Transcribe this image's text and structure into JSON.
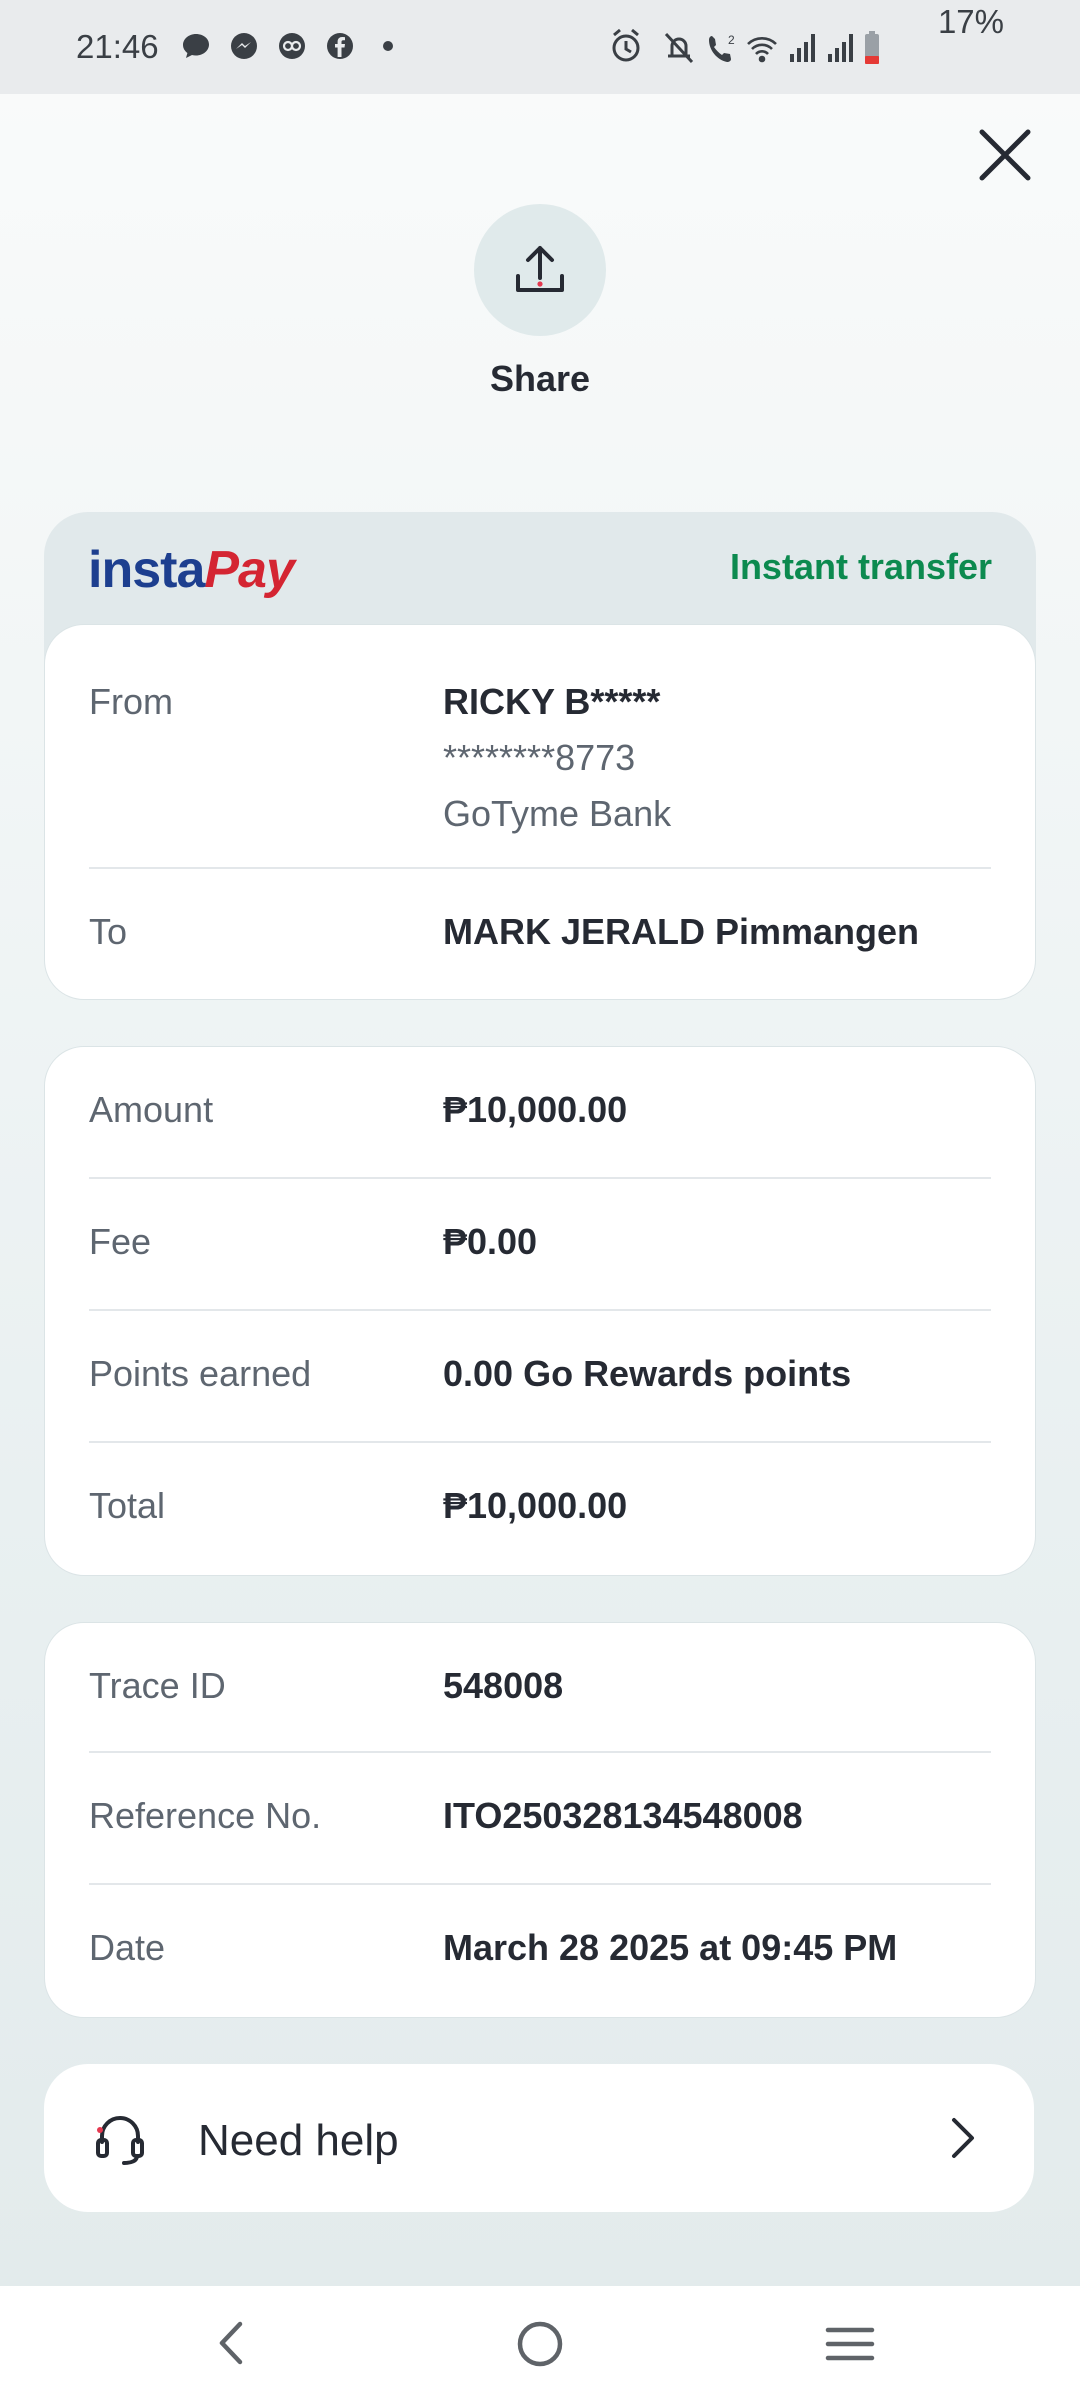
{
  "status_bar": {
    "time": "21:46",
    "battery_percent": "17%",
    "left_icons": [
      "messages-icon",
      "messenger-icon",
      "gotyme-icon",
      "facebook-icon",
      "dot-icon"
    ],
    "right_icons": [
      "alarm-icon",
      "mute-icon",
      "wifi-calling-icon",
      "wifi-icon",
      "signal-icon",
      "signal-icon",
      "battery-icon"
    ],
    "battery_color": "#e53935"
  },
  "header": {
    "close_icon": "close-icon",
    "share_label": "Share",
    "share_icon": "share-upload-icon"
  },
  "instapay": {
    "logo_insta": "insta",
    "logo_pay": "Pay",
    "transfer_type": "Instant transfer",
    "transfer_type_color": "#0c8a4f"
  },
  "parties": {
    "from_label": "From",
    "from_name": "RICKY B*****",
    "from_account": "********8773",
    "from_bank": "GoTyme Bank",
    "to_label": "To",
    "to_name": "MARK JERALD Pimmangen"
  },
  "amounts": [
    {
      "label": "Amount",
      "value": "₱10,000.00"
    },
    {
      "label": "Fee",
      "value": "₱0.00"
    },
    {
      "label": "Points earned",
      "value": "0.00 Go Rewards points"
    },
    {
      "label": "Total",
      "value": "₱10,000.00"
    }
  ],
  "details": [
    {
      "label": "Trace ID",
      "value": "548008"
    },
    {
      "label": "Reference No.",
      "value": "ITO250328134548008"
    },
    {
      "label": "Date",
      "value": "March 28 2025 at 09:45 PM"
    }
  ],
  "help": {
    "label": "Need help",
    "icon": "headset-icon",
    "chevron": "chevron-right-icon"
  },
  "nav": {
    "back_icon": "back-icon",
    "home_icon": "home-icon",
    "recents_icon": "recents-icon"
  }
}
